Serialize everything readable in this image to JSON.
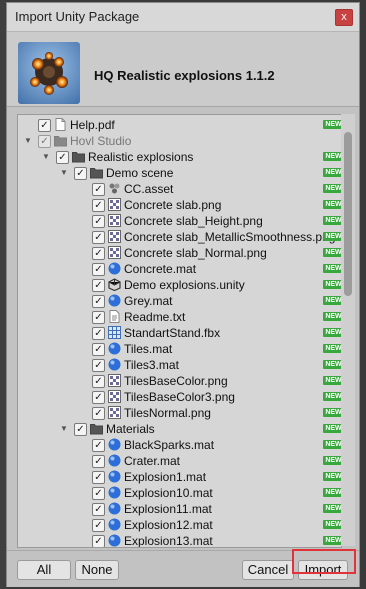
{
  "window": {
    "title": "Import Unity Package",
    "close_glyph": "x"
  },
  "package": {
    "name": "HQ Realistic explosions 1.1.2",
    "icon": "package-thumbnail-icon"
  },
  "new_badge": "NEW",
  "tree": [
    {
      "label": "Help.pdf",
      "icon": "file",
      "depth": 0,
      "checked": true,
      "new": true
    },
    {
      "label": "Hovl Studio",
      "icon": "folder",
      "depth": 0,
      "checked": true,
      "dim": true,
      "expanded": true,
      "new": false
    },
    {
      "label": "Realistic explosions",
      "icon": "folder",
      "depth": 1,
      "checked": true,
      "expanded": true,
      "new": true
    },
    {
      "label": "Demo scene",
      "icon": "folder",
      "depth": 2,
      "checked": true,
      "expanded": true,
      "new": true
    },
    {
      "label": "CC.asset",
      "icon": "asset",
      "depth": 3,
      "checked": true,
      "new": true
    },
    {
      "label": "Concrete slab.png",
      "icon": "texture",
      "depth": 3,
      "checked": true,
      "new": true
    },
    {
      "label": "Concrete slab_Height.png",
      "icon": "texture",
      "depth": 3,
      "checked": true,
      "new": true
    },
    {
      "label": "Concrete slab_MetallicSmoothness.png",
      "icon": "texture",
      "depth": 3,
      "checked": true,
      "new": true
    },
    {
      "label": "Concrete slab_Normal.png",
      "icon": "texture",
      "depth": 3,
      "checked": true,
      "new": true
    },
    {
      "label": "Concrete.mat",
      "icon": "material",
      "depth": 3,
      "checked": true,
      "new": true
    },
    {
      "label": "Demo explosions.unity",
      "icon": "unity",
      "depth": 3,
      "checked": true,
      "new": true
    },
    {
      "label": "Grey.mat",
      "icon": "material",
      "depth": 3,
      "checked": true,
      "new": true
    },
    {
      "label": "Readme.txt",
      "icon": "text",
      "depth": 3,
      "checked": true,
      "new": true
    },
    {
      "label": "StandartStand.fbx",
      "icon": "mesh",
      "depth": 3,
      "checked": true,
      "new": true
    },
    {
      "label": "Tiles.mat",
      "icon": "material",
      "depth": 3,
      "checked": true,
      "new": true
    },
    {
      "label": "Tiles3.mat",
      "icon": "material",
      "depth": 3,
      "checked": true,
      "new": true
    },
    {
      "label": "TilesBaseColor.png",
      "icon": "texture",
      "depth": 3,
      "checked": true,
      "new": true
    },
    {
      "label": "TilesBaseColor3.png",
      "icon": "texture",
      "depth": 3,
      "checked": true,
      "new": true
    },
    {
      "label": "TilesNormal.png",
      "icon": "texture",
      "depth": 3,
      "checked": true,
      "new": true
    },
    {
      "label": "Materials",
      "icon": "folder",
      "depth": 2,
      "checked": true,
      "expanded": true,
      "new": true
    },
    {
      "label": "BlackSparks.mat",
      "icon": "material",
      "depth": 3,
      "checked": true,
      "new": true
    },
    {
      "label": "Crater.mat",
      "icon": "material",
      "depth": 3,
      "checked": true,
      "new": true
    },
    {
      "label": "Explosion1.mat",
      "icon": "material",
      "depth": 3,
      "checked": true,
      "new": true
    },
    {
      "label": "Explosion10.mat",
      "icon": "material",
      "depth": 3,
      "checked": true,
      "new": true
    },
    {
      "label": "Explosion11.mat",
      "icon": "material",
      "depth": 3,
      "checked": true,
      "new": true
    },
    {
      "label": "Explosion12.mat",
      "icon": "material",
      "depth": 3,
      "checked": true,
      "new": true
    },
    {
      "label": "Explosion13.mat",
      "icon": "material",
      "depth": 3,
      "checked": true,
      "new": true
    }
  ],
  "footer": {
    "all_label": "All",
    "none_label": "None",
    "cancel_label": "Cancel",
    "import_label": "Import"
  },
  "colors": {
    "new_badge": "#38a83e",
    "highlight": "#e0333a",
    "material_icon": "#2d6fd6"
  }
}
